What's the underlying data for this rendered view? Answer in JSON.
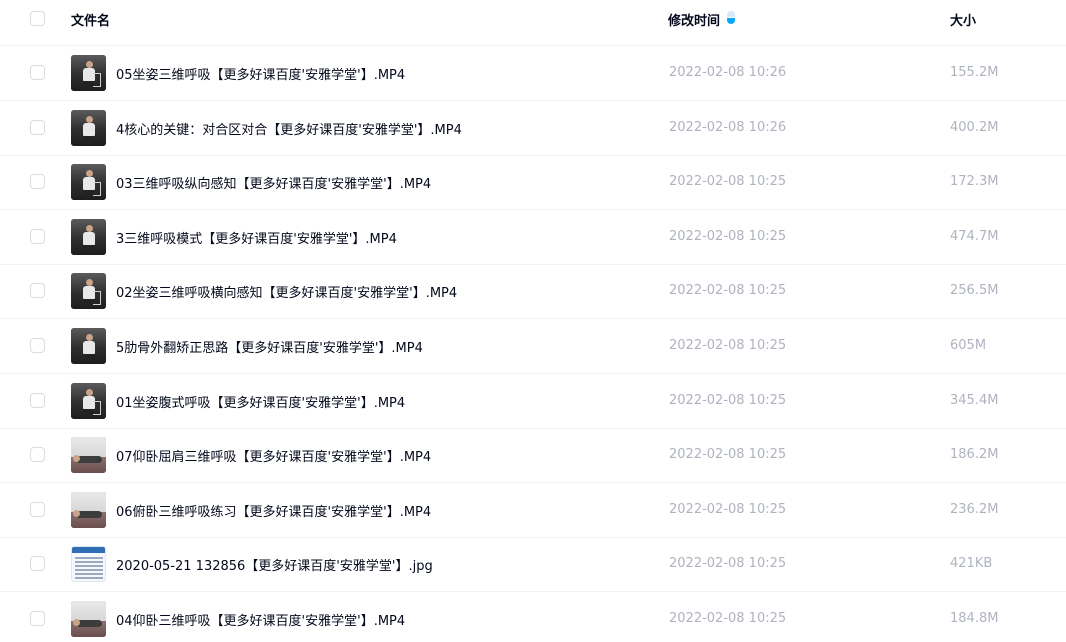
{
  "header": {
    "name_label": "文件名",
    "time_label": "修改时间",
    "size_label": "大小",
    "sort_icon": "sort-desc-icon",
    "accent_color": "#06a7ff"
  },
  "files": [
    {
      "name": "05坐姿三维呼吸【更多好课百度'安雅学堂'】.MP4",
      "time": "2022-02-08 10:26",
      "size": "155.2M",
      "thumb": "video-sitting"
    },
    {
      "name": "4核心的关键：对合区对合【更多好课百度'安雅学堂'】.MP4",
      "time": "2022-02-08 10:26",
      "size": "400.2M",
      "thumb": "video-standing"
    },
    {
      "name": "03三维呼吸纵向感知【更多好课百度'安雅学堂'】.MP4",
      "time": "2022-02-08 10:25",
      "size": "172.3M",
      "thumb": "video-sitting"
    },
    {
      "name": "3三维呼吸模式【更多好课百度'安雅学堂'】.MP4",
      "time": "2022-02-08 10:25",
      "size": "474.7M",
      "thumb": "video-standing"
    },
    {
      "name": "02坐姿三维呼吸横向感知【更多好课百度'安雅学堂'】.MP4",
      "time": "2022-02-08 10:25",
      "size": "256.5M",
      "thumb": "video-sitting"
    },
    {
      "name": "5肋骨外翻矫正思路【更多好课百度'安雅学堂'】.MP4",
      "time": "2022-02-08 10:25",
      "size": "605M",
      "thumb": "video-standing"
    },
    {
      "name": "01坐姿腹式呼吸【更多好课百度'安雅学堂'】.MP4",
      "time": "2022-02-08 10:25",
      "size": "345.4M",
      "thumb": "video-sitting"
    },
    {
      "name": "07仰卧屈肩三维呼吸【更多好课百度'安雅学堂'】.MP4",
      "time": "2022-02-08 10:25",
      "size": "186.2M",
      "thumb": "video-lying"
    },
    {
      "name": "06俯卧三维呼吸练习【更多好课百度'安雅学堂'】.MP4",
      "time": "2022-02-08 10:25",
      "size": "236.2M",
      "thumb": "video-lying"
    },
    {
      "name": "2020-05-21 132856【更多好课百度'安雅学堂'】.jpg",
      "time": "2022-02-08 10:25",
      "size": "421KB",
      "thumb": "image-document"
    },
    {
      "name": "04仰卧三维呼吸【更多好课百度'安雅学堂'】.MP4",
      "time": "2022-02-08 10:25",
      "size": "184.8M",
      "thumb": "video-lying"
    }
  ]
}
